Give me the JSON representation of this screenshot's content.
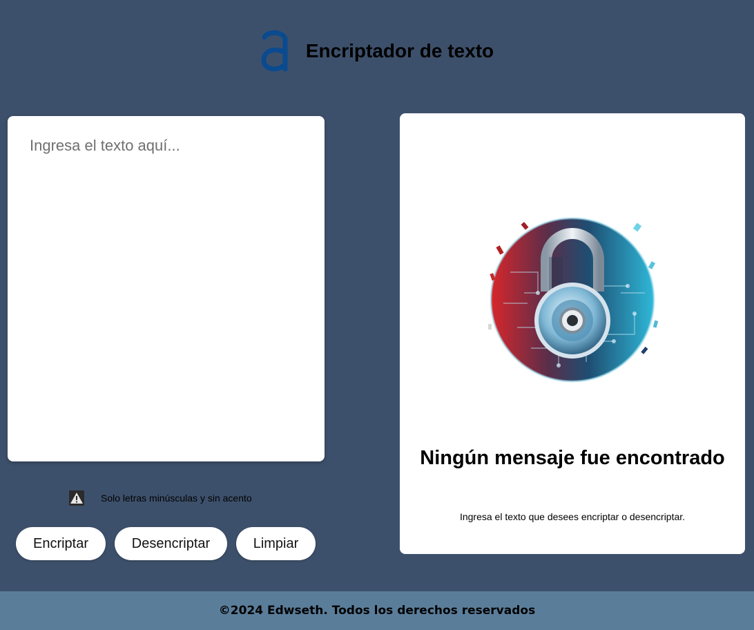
{
  "header": {
    "title": "Encriptador de texto",
    "logo_icon": "alura-a-logo-icon",
    "logo_color": "#0a4a8f"
  },
  "input": {
    "placeholder": "Ingresa el texto aquí...",
    "value": ""
  },
  "hint": {
    "icon": "warning-icon",
    "text": "Solo letras minúsculas y sin acento"
  },
  "buttons": {
    "encrypt_label": "Encriptar",
    "decrypt_label": "Desencriptar",
    "clear_label": "Limpiar"
  },
  "output": {
    "image": "padlock-circuit-illustration",
    "title": "Ningún mensaje fue encontrado",
    "subtitle": "Ingresa el texto que desees encriptar o desencriptar."
  },
  "footer": {
    "text": "©2024 Edwseth. Todos los derechos reservados"
  },
  "colors": {
    "background": "#3d506b",
    "footer": "#5a7d9a",
    "card": "#ffffff"
  }
}
